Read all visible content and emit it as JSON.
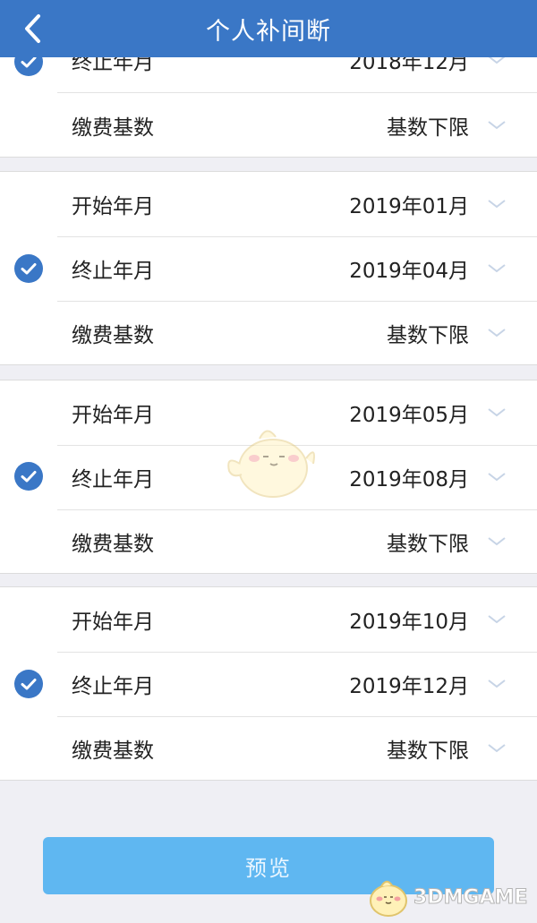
{
  "header": {
    "title": "个人补间断"
  },
  "groups": [
    {
      "rows": [
        {
          "label": "终止年月",
          "value": "2018年12月"
        },
        {
          "label": "缴费基数",
          "value": "基数下限"
        }
      ],
      "checked": true
    },
    {
      "rows": [
        {
          "label": "开始年月",
          "value": "2019年01月"
        },
        {
          "label": "终止年月",
          "value": "2019年04月"
        },
        {
          "label": "缴费基数",
          "value": "基数下限"
        }
      ],
      "checked": true
    },
    {
      "rows": [
        {
          "label": "开始年月",
          "value": "2019年05月"
        },
        {
          "label": "终止年月",
          "value": "2019年08月"
        },
        {
          "label": "缴费基数",
          "value": "基数下限"
        }
      ],
      "checked": true
    },
    {
      "rows": [
        {
          "label": "开始年月",
          "value": "2019年10月"
        },
        {
          "label": "终止年月",
          "value": "2019年12月"
        },
        {
          "label": "缴费基数",
          "value": "基数下限"
        }
      ],
      "checked": true
    }
  ],
  "footer": {
    "preview_label": "预览"
  },
  "watermark": {
    "text": "3DMGAME"
  },
  "colors": {
    "nav_bg": "#3a77c6",
    "check_blue": "#3a77c6",
    "button_bg": "#5fb7f1",
    "page_bg": "#efeff4"
  },
  "icons": {
    "back": "chevron-left-icon",
    "row_dropdown": "chevron-down-icon",
    "selected": "check-circle-icon"
  }
}
